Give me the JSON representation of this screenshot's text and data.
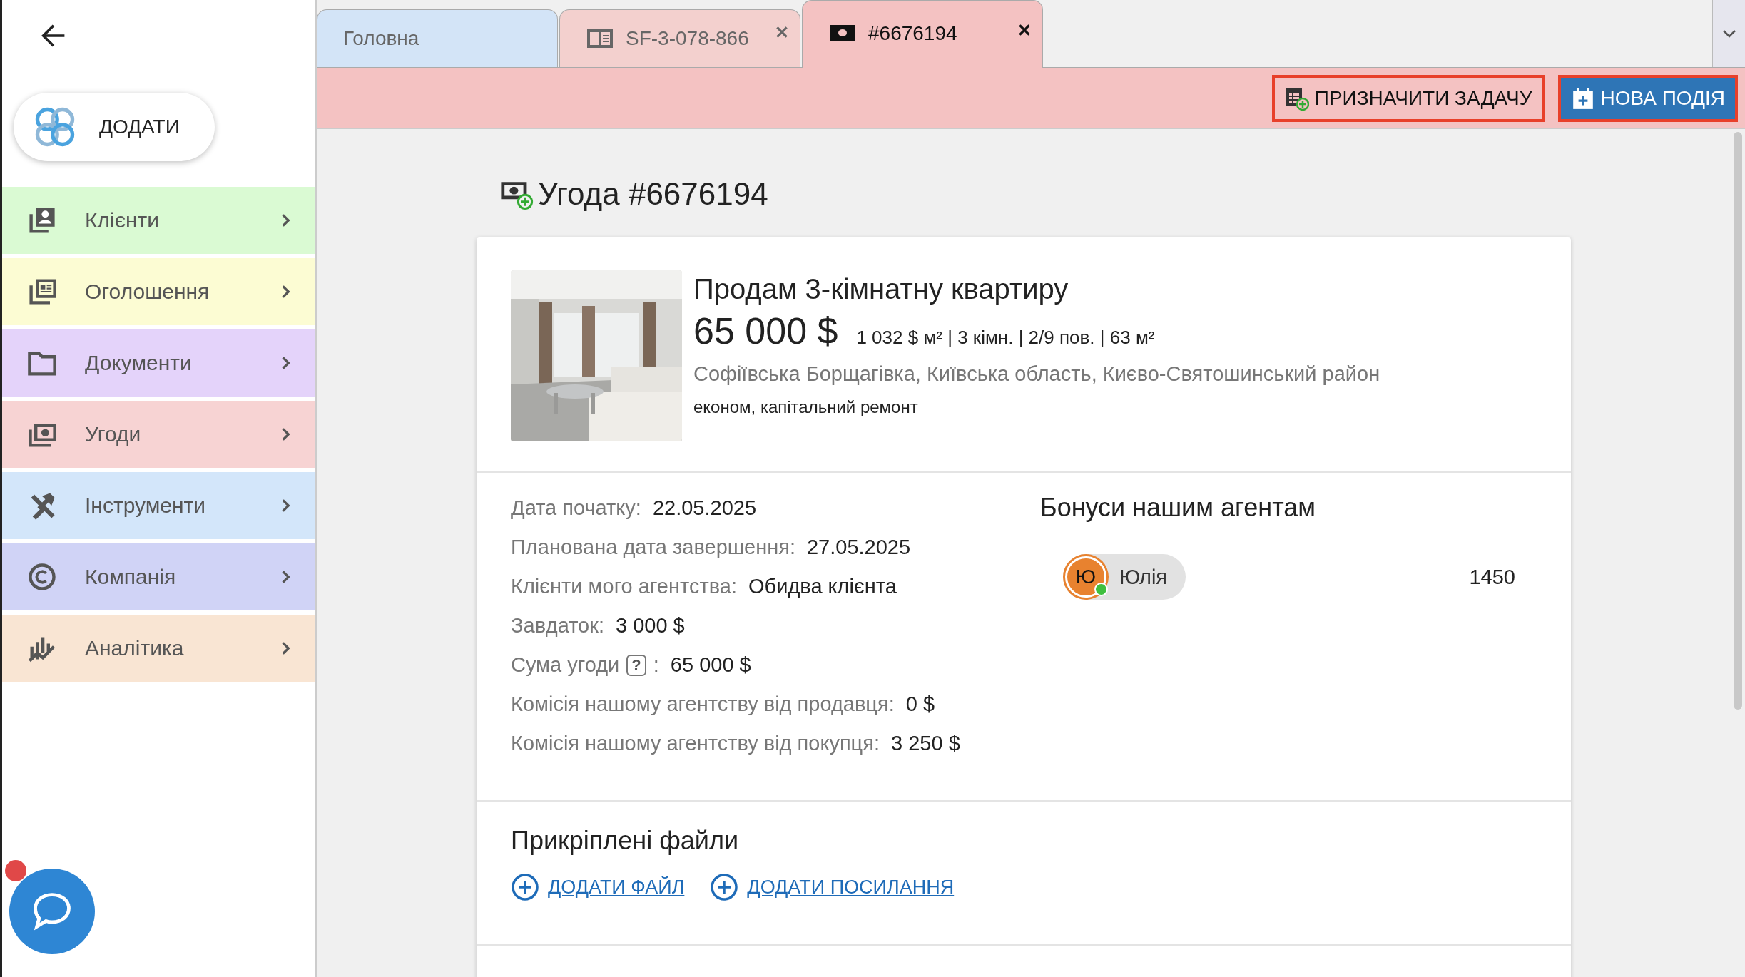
{
  "sidebar": {
    "add_button": {
      "label": "ДОДАТИ"
    },
    "items": [
      {
        "label": "Клієнти",
        "color": "#dafad3"
      },
      {
        "label": "Оголошення",
        "color": "#fcfcd3"
      },
      {
        "label": "Документи",
        "color": "#e4d3fa"
      },
      {
        "label": "Угоди",
        "color": "#f7d3d3"
      },
      {
        "label": "Інструменти",
        "color": "#d3e6fa"
      },
      {
        "label": "Компанія",
        "color": "#d0d3f6"
      },
      {
        "label": "Аналітика",
        "color": "#f9e5d3"
      }
    ],
    "chat": {
      "unread": true
    }
  },
  "tabs": [
    {
      "label": "Головна",
      "selected": false,
      "closable": false,
      "color": "#d3e4f7"
    },
    {
      "label": "SF-3-078-866",
      "selected": false,
      "closable": true,
      "color": "#f3d0ce"
    },
    {
      "label": "#6676194",
      "selected": true,
      "closable": true,
      "color": "#f4c2c2"
    }
  ],
  "actions": [
    {
      "label": "ПРИЗНАЧИТИ ЗАДАЧУ",
      "kind": "outline"
    },
    {
      "label": "НОВА ПОДІЯ",
      "kind": "primary"
    }
  ],
  "page_title": "Угода #6676194",
  "listing": {
    "title": "Продам 3-кімнатну квартиру",
    "price": "65 000 $",
    "specs": "1 032 $ м² | 3 кімн. | 2/9 пов. | 63 м²",
    "address": "Софіївська Борщагівка, Київська область, Києво-Святошинський район",
    "tags": "економ, капітальний ремонт"
  },
  "details": [
    {
      "label": "Дата початку:",
      "value": "22.05.2025"
    },
    {
      "label": "Планована дата завершення:",
      "value": "27.05.2025"
    },
    {
      "label": "Клієнти мого агентства:",
      "value": "Обидва клієнта"
    },
    {
      "label": "Завдаток:",
      "value": "3 000 $"
    },
    {
      "label": "Сума угоди",
      "help": "?",
      "suffix": ":",
      "value": "65 000 $"
    },
    {
      "label": "Комісія нашому агентству від продавця:",
      "value": "0 $"
    },
    {
      "label": "Комісія нашому агентству від покупця:",
      "value": "3 250 $"
    }
  ],
  "bonuses": {
    "title": "Бонуси нашим агентам",
    "agents": [
      {
        "initial": "Ю",
        "name": "Юлія",
        "online": true,
        "amount": "1450"
      }
    ]
  },
  "files": {
    "title": "Прикріплені файли",
    "links": [
      "ДОДАТИ ФАЙЛ",
      "ДОДАТИ ПОСИЛАННЯ"
    ]
  }
}
